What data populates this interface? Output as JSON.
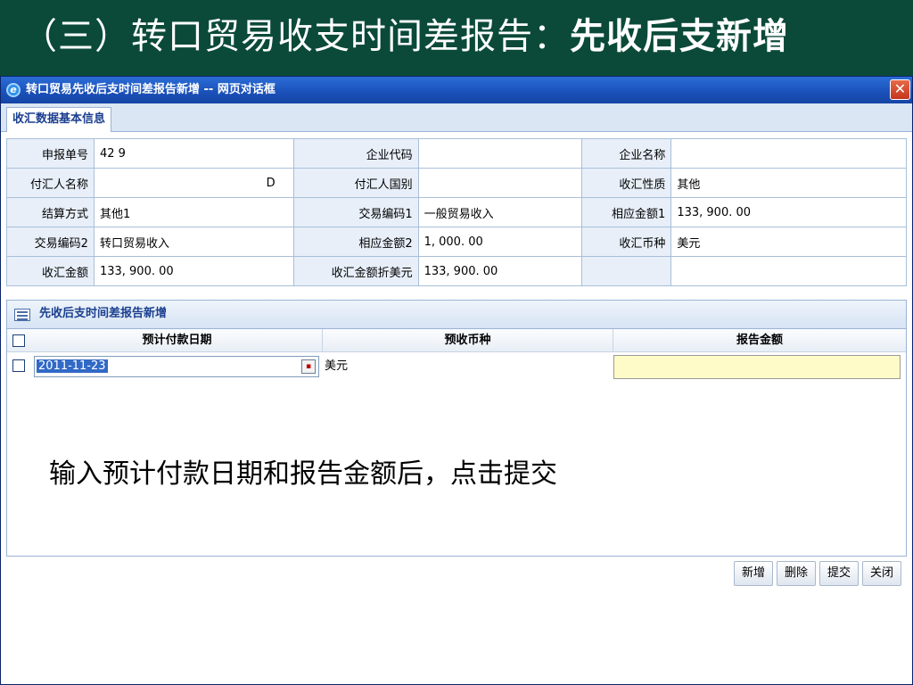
{
  "slide": {
    "title_prefix": "（三）转口贸易收支时间差报告：",
    "title_bold": "先收后支新增"
  },
  "window": {
    "title": "转口贸易先收后支时间差报告新增 -- 网页对话框",
    "close_glyph": "✕",
    "ie_glyph": "e"
  },
  "tabs": [
    {
      "label": "收汇数据基本信息"
    }
  ],
  "info": {
    "rows": [
      [
        {
          "label": "申报单号",
          "value": "42                   9"
        },
        {
          "label": "企业代码",
          "value": ""
        },
        {
          "label": "企业名称",
          "value": ""
        }
      ],
      [
        {
          "label": "付汇人名称",
          "value": "D"
        },
        {
          "label": "付汇人国别",
          "value": ""
        },
        {
          "label": "收汇性质",
          "value": "其他"
        }
      ],
      [
        {
          "label": "结算方式",
          "value": "其他1"
        },
        {
          "label": "交易编码1",
          "value": "一般贸易收入"
        },
        {
          "label": "相应金额1",
          "value": "133, 900. 00"
        }
      ],
      [
        {
          "label": "交易编码2",
          "value": "转口贸易收入"
        },
        {
          "label": "相应金额2",
          "value": "1, 000. 00"
        },
        {
          "label": "收汇币种",
          "value": "美元"
        }
      ],
      [
        {
          "label": "收汇金额",
          "value": "133, 900. 00"
        },
        {
          "label": "收汇金额折美元",
          "value": "133, 900. 00"
        },
        {
          "label": "",
          "value": ""
        }
      ]
    ]
  },
  "panel": {
    "title": "先收后支时间差报告新增",
    "columns": [
      "预计付款日期",
      "预收币种",
      "报告金额"
    ],
    "row": {
      "date": "2011-11-23",
      "currency": "美元",
      "amount": ""
    },
    "calendar_glyph": "▪"
  },
  "hint": "输入预计付款日期和报告金额后，点击提交",
  "buttons": {
    "add": "新增",
    "delete": "删除",
    "submit": "提交",
    "close": "关闭"
  },
  "colors": {
    "slide_bg": "#0b4a38",
    "titlebar": "#1a4fb8",
    "amount_field": "#fffbc8"
  }
}
